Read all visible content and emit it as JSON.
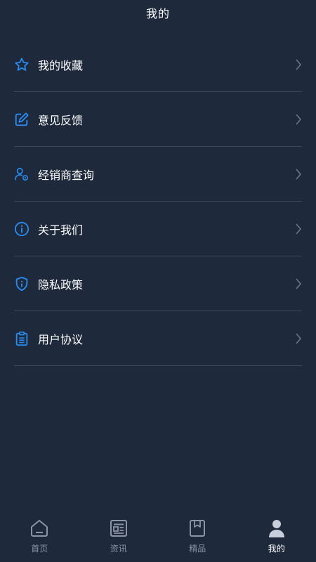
{
  "header": {
    "title": "我的"
  },
  "menu": {
    "items": [
      {
        "label": "我的收藏",
        "icon": "star-icon"
      },
      {
        "label": "意见反馈",
        "icon": "edit-icon"
      },
      {
        "label": "经销商查询",
        "icon": "dealer-user-icon"
      },
      {
        "label": "关于我们",
        "icon": "info-icon"
      },
      {
        "label": "隐私政策",
        "icon": "shield-icon"
      },
      {
        "label": "用户协议",
        "icon": "clipboard-icon"
      }
    ]
  },
  "tabbar": {
    "tabs": [
      {
        "label": "首页",
        "icon": "home-icon",
        "active": false
      },
      {
        "label": "资讯",
        "icon": "news-icon",
        "active": false
      },
      {
        "label": "精品",
        "icon": "bookmark-icon",
        "active": false
      },
      {
        "label": "我的",
        "icon": "person-icon",
        "active": true
      }
    ]
  },
  "colors": {
    "background": "#1e293c",
    "accent_blue": "#2a8cf0",
    "divider": "#3a465a",
    "inactive_tab": "#8a94a6",
    "active_tab": "#ffffff"
  }
}
